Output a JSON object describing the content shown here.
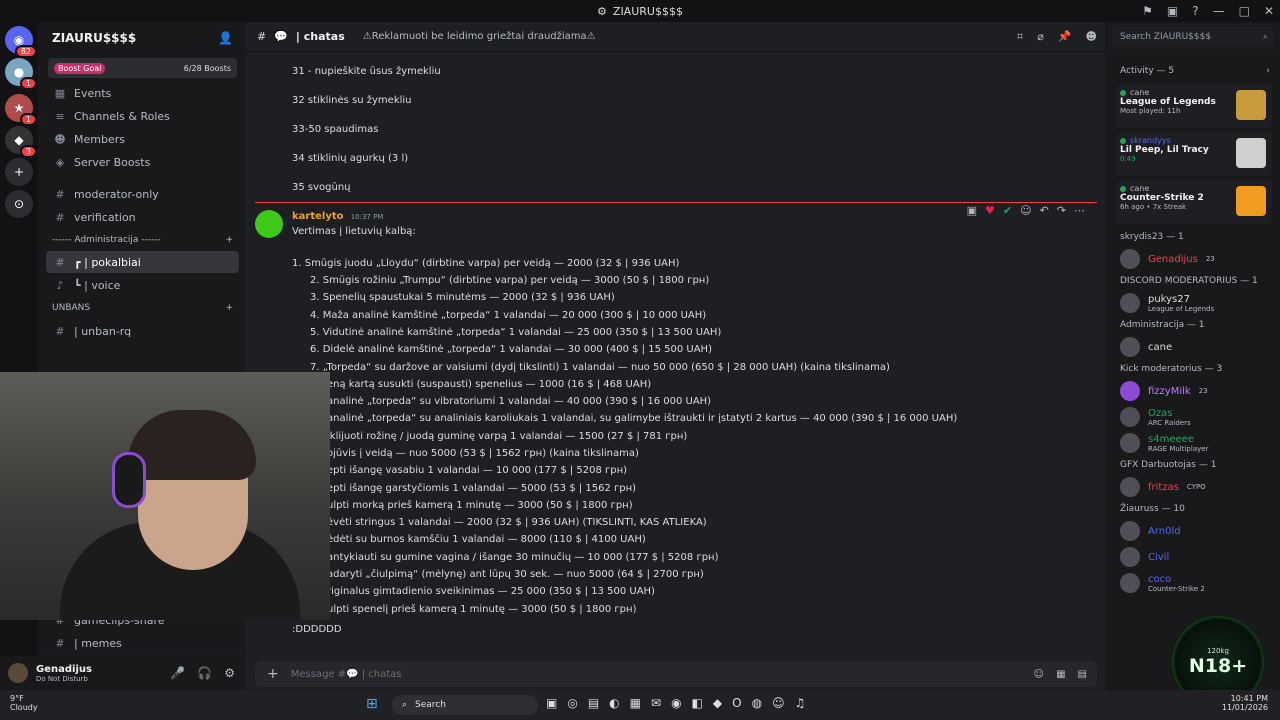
{
  "window": {
    "title": "ZIAURU$$$$",
    "controls": [
      "—",
      "□",
      "✕"
    ]
  },
  "servers": [
    {
      "name": "Discord Home",
      "badge": "82"
    },
    {
      "name": "Server 1",
      "badge": "1"
    },
    {
      "name": "Server 2",
      "badge": "1"
    },
    {
      "name": "Server 3",
      "badge": "3"
    },
    {
      "name": "Add server"
    },
    {
      "name": "Discover"
    }
  ],
  "sidebar": {
    "server_name": "ZIAURU$$$$",
    "boost_goal_label": "Boost Goal",
    "boost_count": "6/28 Boosts",
    "nav": [
      {
        "label": "Events"
      },
      {
        "label": "Channels & Roles"
      },
      {
        "label": "Members"
      },
      {
        "label": "Server Boosts"
      }
    ],
    "channels_before": [
      "moderator-only",
      "verification"
    ],
    "category_admin": "------ Administracija ------",
    "admin_channels": [
      "┏ | pokalbiai",
      "┗ | voice"
    ],
    "category_unbans": "UNBANS",
    "unban_channels": [
      "| unban-rq"
    ],
    "bottom_channels": [
      "gameclips-share",
      "| memes"
    ]
  },
  "user": {
    "name": "Genadijus",
    "status": "Do Not Disturb"
  },
  "channel": {
    "name": "| chatas",
    "topic": "⚠Reklamuoti be leidimo griežtai draudžiama⚠"
  },
  "messages": {
    "list_top": [
      "31 - nupieškite ūsus žymekliu",
      "32 stiklinės su žymekliu",
      "33-50 spaudimas",
      "34 stiklinių agurkų (3 l)",
      "35 svogūnų"
    ],
    "author": "kartelyto",
    "timestamp": "10:37 PM",
    "intro": "Vertimas į lietuvių kalbą:",
    "items": [
      "1. Smūgis juodu „Lloydu“ (dirbtine varpa) per veidą — 2000 (32 $ | 936 UAH)",
      "2. Smūgis rožiniu „Trumpu“ (dirbtine varpa) per veidą — 3000 (50 $ | 1800 грн)",
      "3. Spenelių spaustukai 5 minutėms — 2000 (32 $ | 936 UAH)",
      "4. Maža analinė kamštinė „torpeda“ 1 valandai — 20 000 (300 $ | 10 000 UAH)",
      "5. Vidutinė analinė kamštinė „torpeda“ 1 valandai — 25 000 (350 $ | 13 500 UAH)",
      "6. Didelė analinė kamštinė „torpeda“ 1 valandai — 30 000 (400 $ | 15 500 UAH)",
      "7. „Torpeda“ su daržove ar vaisiumi (dydį tikslinti) 1 valandai — nuo 50 000 (650 $ | 28 000 UAH) (kaina tikslinama)",
      "eną kartą susukti (suspausti) spenelius — 1000 (16 $ | 468 UAH)",
      "analinė „torpeda“ su vibratoriumi 1 valandai — 40 000 (390 $ | 16 000 UAH)",
      "analinė „torpeda“ su analiniais karoliukais 1 valandai, su galimybe ištraukti ir įstatyti 2 kartus — 40 000 (390 $ | 16 000 UAH)",
      "iklijuoti rožinę / juodą guminę varpą 1 valandai — 1500 (27 $ | 781 грн)",
      "ojūvis į veidą — nuo 5000 (53 $ | 1562 грн) (kaina tikslinama)",
      "epti išangę vasabiu 1 valandai — 10 000 (177 $ | 5208 грн)",
      "epti išangę garstyčiomis 1 valandai — 5000 (53 $ | 1562 грн)",
      "ulpti morką prieš kamerą 1 minutę — 3000 (50 $ | 1800 грн)",
      "ėvėti stringus 1 valandai — 2000 (32 $ | 936 UAH) (TIKSLINTI, KAS ATLIEKA)",
      "ėdėti su burnos kamščiu 1 valandai — 8000 (110 $ | 4100 UAH)",
      "antykiauti su gumine vagina / išange 30 minučių — 10 000 (177 $ | 5208 грн)",
      "adaryti „čiulpimą“ (mėlynę) ant lūpų 30 sek. — nuo 5000 (64 $ | 2700 грн)",
      "riginalus gimtadienio sveikinimas — 25 000 (350 $ | 13 500 UAH)",
      "ulpti spenelį prieš kamerą 1 minutę — 3000 (50 $ | 1800 грн)"
    ],
    "last": ":DDDDDD"
  },
  "composer": {
    "placeholder": "Message #💬 | chatas"
  },
  "search": {
    "placeholder": "Search ZIAURU$$$$"
  },
  "members": {
    "activity_header": "Activity — 5",
    "activities": [
      {
        "user": "cane",
        "game": "League of Legends",
        "sub": "Most played: 11h",
        "thumb_color": "#c89b3c"
      },
      {
        "user": "skrandyys",
        "game": "Lil Peep, Lil Tracy",
        "sub": "0:49",
        "thumb_color": "#cfcfcf"
      },
      {
        "user": "cane",
        "game": "Counter-Strike 2",
        "sub": "6h ago • 7x Streak",
        "thumb_color": "#f29c1f"
      }
    ],
    "groups": [
      {
        "title": "skrydis23 — 1",
        "members": [
          {
            "name": "Genadijus",
            "status": "23",
            "color": "#f23f43"
          }
        ]
      },
      {
        "title": "DISCORD MODERATORIUS — 1",
        "members": [
          {
            "name": "pukys27",
            "status": "League of Legends",
            "color": "#dbdee1"
          }
        ]
      },
      {
        "title": "Administracija — 1",
        "members": [
          {
            "name": "cane",
            "status": "",
            "color": "#dbdee1"
          }
        ]
      },
      {
        "title": "Kick moderatorius — 3",
        "members": [
          {
            "name": "fizzyMilk",
            "status": "23",
            "color": "#c37bff"
          },
          {
            "name": "Ozas",
            "status": "ARC Raiders",
            "color": "#23a55a"
          },
          {
            "name": "s4meeee",
            "status": "RAGE Multiplayer",
            "color": "#23a55a"
          }
        ]
      },
      {
        "title": "GFX Darbuotojas — 1",
        "members": [
          {
            "name": "fritzas",
            "status": "CYPO",
            "color": "#f23f43"
          }
        ]
      },
      {
        "title": "Žiauruss — 10",
        "members": [
          {
            "name": "Arn0ld",
            "status": "",
            "color": "#5865f2"
          },
          {
            "name": "Civil",
            "status": "",
            "color": "#5865f2"
          },
          {
            "name": "coco",
            "status": "Counter-Strike 2",
            "color": "#5865f2"
          }
        ]
      }
    ]
  },
  "overlay": {
    "badge": "N18+",
    "points": "120kg"
  },
  "taskbar": {
    "weather_temp": "9°F",
    "weather_desc": "Cloudy",
    "search_label": "Search",
    "time": "10:41 PM",
    "date": "11/01/2026"
  }
}
